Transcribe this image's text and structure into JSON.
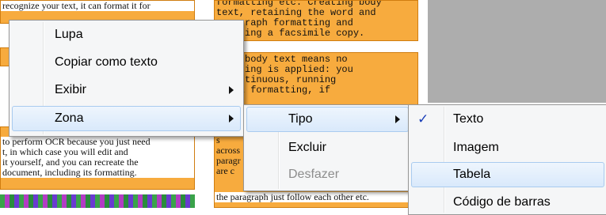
{
  "document": {
    "left_top": "recognize your text, it can format it for",
    "left_top_tail": "for",
    "left_bottom_lines": [
      "to perform OCR because you just need",
      "t, in which case you will edit and",
      "it yourself, and you can recreate the",
      "document, including its formatting."
    ],
    "right_top_lines": [
      "formatting etc. Creating body",
      "text, retaining the word and",
      "paragraph formatting and",
      "creating a facsimile copy."
    ],
    "right_mid_lines": [
      "ting body text means no",
      "rmatting is applied: you",
      "a continuous, running",
      ". All formatting, if"
    ],
    "right_bottom_lines": [
      "s",
      "across",
      "paragr",
      "are c",
      "the paragraph just follow each other etc."
    ]
  },
  "menu_main": {
    "items": [
      {
        "label": "Lupa"
      },
      {
        "label": "Copiar como texto"
      },
      {
        "label": "Exibir",
        "submenu": true
      },
      {
        "label": "Zona",
        "submenu": true,
        "highlighted": true
      }
    ]
  },
  "menu_zona": {
    "items": [
      {
        "label": "Tipo",
        "submenu": true,
        "highlighted": true
      },
      {
        "label": "Excluir"
      },
      {
        "label": "Desfazer",
        "disabled": true
      }
    ]
  },
  "menu_tipo": {
    "items": [
      {
        "label": "Texto",
        "checked": true,
        "check_glyph": "✓"
      },
      {
        "label": "Imagem"
      },
      {
        "label": "Tabela",
        "highlighted": true
      },
      {
        "label": "Código de barras"
      }
    ]
  },
  "colors": {
    "zone_fill": "#f7ab3e",
    "menu_bg": "#f5f6f7",
    "highlight_border": "#a9cbef",
    "check": "#1a3fb8"
  }
}
